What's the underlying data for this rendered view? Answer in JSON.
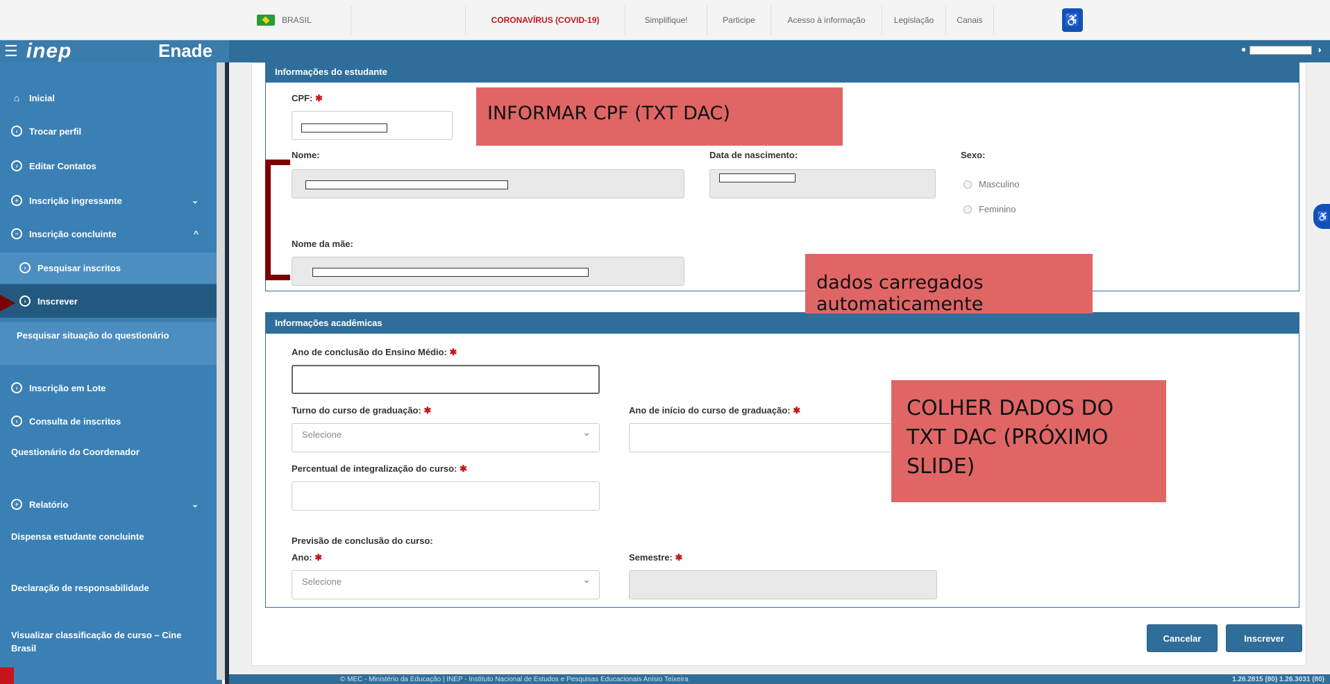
{
  "gov_bar": {
    "country": "BRASIL",
    "links": [
      "CORONAVÍRUS (COVID-19)",
      "Simplifique!",
      "Participe",
      "Acesso à informação",
      "Legislação",
      "Canais"
    ]
  },
  "header": {
    "menu_icon": "hamburger-icon",
    "logo": "inep",
    "app_name": "Enade"
  },
  "sidebar": {
    "items": [
      {
        "label": "Inicial",
        "icon": "home-icon"
      },
      {
        "label": "Trocar perfil"
      },
      {
        "label": "Editar Contatos"
      },
      {
        "label": "Inscrição ingressante",
        "chevron": "⌄"
      },
      {
        "label": "Inscrição concluinte",
        "chevron": "^"
      },
      {
        "label": "Pesquisar inscritos"
      },
      {
        "label": "Inscrever"
      },
      {
        "label": "Pesquisar situação do questionário"
      },
      {
        "label": "Inscrição em Lote"
      },
      {
        "label": "Consulta de inscritos"
      },
      {
        "label": "Questionário do Coordenador"
      },
      {
        "label": "Relatório",
        "chevron": "⌄"
      },
      {
        "label": "Dispensa estudante concluinte",
        "chevron": "⌄"
      },
      {
        "label": "Declaração de responsabilidade",
        "chevron": "⌄"
      },
      {
        "label": "Visualizar classificação de curso – Cine Brasil"
      }
    ]
  },
  "student_panel": {
    "title": "Informações do estudante",
    "cpf_label": "CPF:",
    "name_label": "Nome:",
    "birth_label": "Data de nascimento:",
    "sex_label": "Sexo:",
    "sex_options": [
      "Masculino",
      "Feminino"
    ],
    "mother_label": "Nome da mãe:"
  },
  "academic_panel": {
    "title": "Informações acadêmicas",
    "hs_year_label": "Ano de conclusão do Ensino Médio:",
    "shift_label": "Turno do curso de graduação:",
    "shift_placeholder": "Selecione",
    "start_year_label": "Ano de início do curso de graduação:",
    "percent_label": "Percentual de integralização do curso:",
    "forecast_label": "Previsão de conclusão do curso:",
    "year_label": "Ano:",
    "year_placeholder": "Selecione",
    "semester_label": "Semestre:"
  },
  "actions": {
    "cancel": "Cancelar",
    "submit": "Inscrever"
  },
  "annotations": {
    "cpf_note": "INFORMAR CPF (TXT DAC)",
    "auto_note": "dados carregados automaticamente",
    "collect_note": "COLHER DADOS DO TXT DAC (PRÓXIMO SLIDE)"
  },
  "footer": {
    "text": "© MEC - Ministério da Educação | INEP - Instituto Nacional de Estudos e Pesquisas Educacionais Anísio Teixeira",
    "version": "1.26.2815 (80) 1.26.3031 (80)"
  },
  "colors": {
    "primary": "#2f6e9a",
    "sidebar": "#3b80b5",
    "annotation": "#e06666",
    "required": "#c4161c"
  }
}
